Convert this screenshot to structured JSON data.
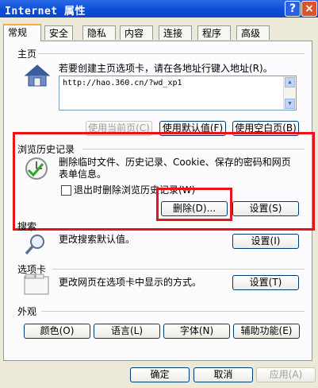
{
  "window": {
    "title": "Internet 属性",
    "help_glyph": "?",
    "close_glyph": "×"
  },
  "tabs": [
    "常规",
    "安全",
    "隐私",
    "内容",
    "连接",
    "程序",
    "高级"
  ],
  "home": {
    "label": "主页",
    "description": "若要创建主页选项卡，请在各地址行键入地址(R)。",
    "url": "http://hao.360.cn/?wd_xp1",
    "use_current": "使用当前页(C)",
    "use_default": "使用默认值(F)",
    "use_blank": "使用空白页(B)"
  },
  "history": {
    "label": "浏览历史记录",
    "description": "删除临时文件、历史记录、Cookie、保存的密码和网页表单信息。",
    "checkbox_label": "退出时删除浏览历史记录(W)",
    "delete_button": "删除(D)...",
    "settings_button": "设置(S)"
  },
  "search": {
    "label": "搜索",
    "description": "更改搜索默认值。",
    "settings_button": "设置(I)"
  },
  "tabs_section": {
    "label": "选项卡",
    "description": "更改网页在选项卡中显示的方式。",
    "settings_button": "设置(T)"
  },
  "appearance": {
    "label": "外观",
    "colors": "颜色(O)",
    "languages": "语言(L)",
    "fonts": "字体(N)",
    "accessibility": "辅助功能(E)"
  },
  "dialog": {
    "ok": "确定",
    "cancel": "取消",
    "apply": "应用(A)"
  },
  "colors": {
    "title_bar": "#0a4bd6",
    "highlight": "#e8141c",
    "dialog_bg": "#ece9d8"
  },
  "icons": [
    "house-icon",
    "clock-icon",
    "magnifier-icon",
    "tabs-icon"
  ]
}
